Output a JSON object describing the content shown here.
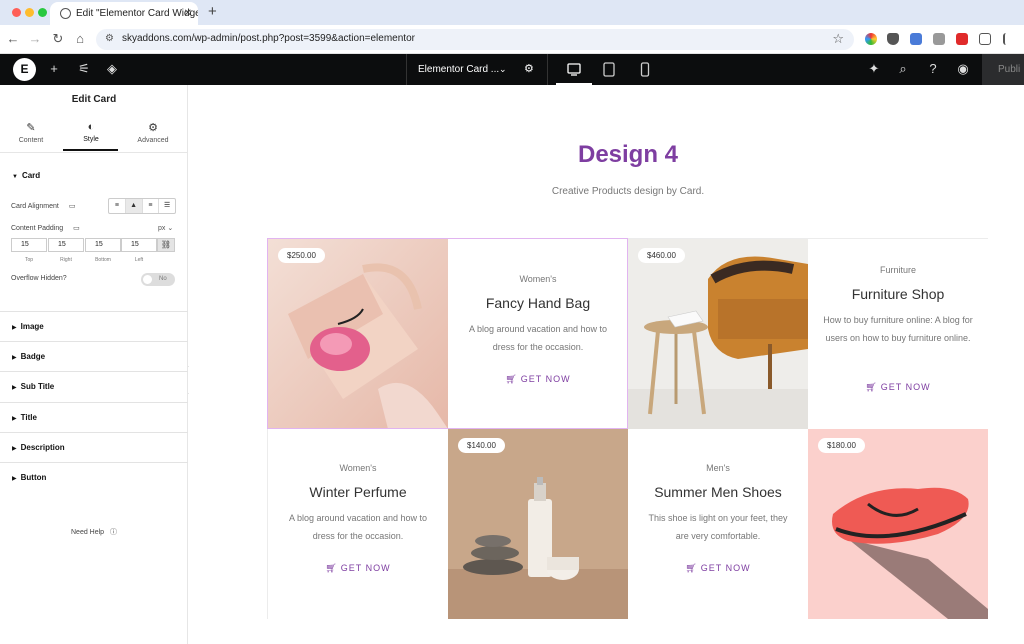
{
  "browser": {
    "tab_title": "Edit \"Elementor Card Widget\"",
    "url": "skyaddons.com/wp-admin/post.php?post=3599&action=elementor"
  },
  "topbar": {
    "doc_title": "Elementor Card ...",
    "publish_label": "Publi"
  },
  "panel": {
    "title": "Edit Card",
    "tabs": [
      {
        "label": "Content",
        "icon": "pencil-icon"
      },
      {
        "label": "Style",
        "icon": "contrast-icon"
      },
      {
        "label": "Advanced",
        "icon": "gear-icon"
      }
    ],
    "active_tab": "Style",
    "section_title": "Card",
    "card_alignment_label": "Card Alignment",
    "content_padding_label": "Content Padding",
    "padding_unit": "px",
    "padding": [
      {
        "value": "15",
        "caption": "Top"
      },
      {
        "value": "15",
        "caption": "Right"
      },
      {
        "value": "15",
        "caption": "Bottom"
      },
      {
        "value": "15",
        "caption": "Left"
      }
    ],
    "overflow_label": "Overflow Hidden?",
    "overflow_value": "No",
    "accordions": [
      "Image",
      "Badge",
      "Sub Title",
      "Title",
      "Description",
      "Button"
    ],
    "need_help": "Need Help"
  },
  "canvas": {
    "heading": "Design 4",
    "subheading": "Creative Products design by Card.",
    "accent_color": "#7e3ea1",
    "button_label": "GET NOW",
    "cards": [
      {
        "category": "Women's",
        "title": "Fancy Hand Bag",
        "description": "A blog around vacation and how to dress for the occasion.",
        "price": "$250.00"
      },
      {
        "category": "Furniture",
        "title": "Furniture Shop",
        "description": "How to buy furniture online: A blog for users on how to buy furniture online.",
        "price": "$460.00"
      },
      {
        "category": "Women's",
        "title": "Winter Perfume",
        "description": "A blog around vacation and how to dress for the occasion.",
        "price": "$140.00"
      },
      {
        "category": "Men's",
        "title": "Summer Men Shoes",
        "description": "This shoe is light on your feet, they are very comfortable.",
        "price": "$180.00"
      }
    ]
  }
}
